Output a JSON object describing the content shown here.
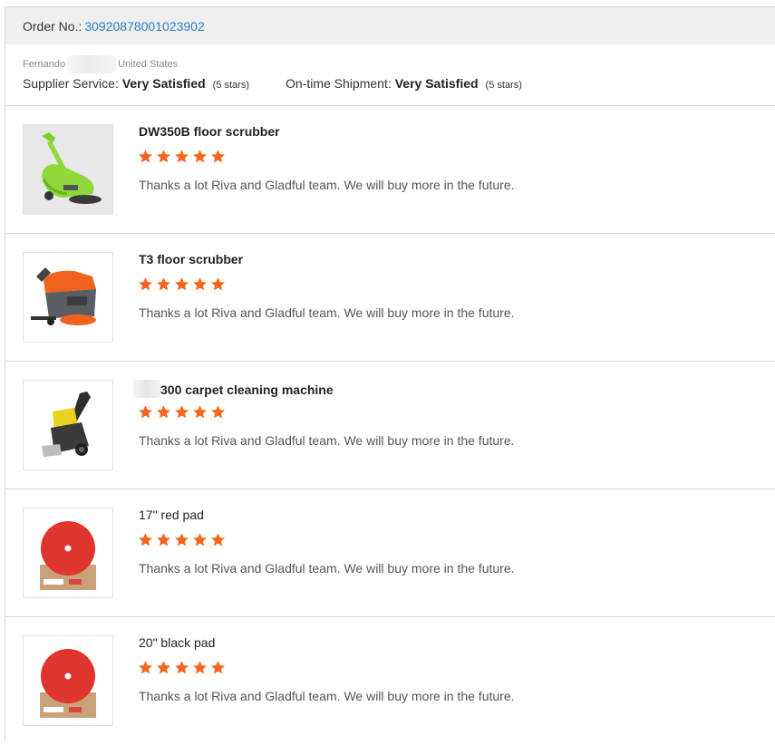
{
  "order": {
    "label": "Order No.:",
    "number": "30920878001023902"
  },
  "reviewer": {
    "name": "Fernando",
    "country": "United States"
  },
  "ratings": {
    "supplier_label": "Supplier Service:",
    "supplier_value": "Very Satisfied",
    "supplier_stars": "(5 stars)",
    "shipment_label": "On-time Shipment:",
    "shipment_value": "Very Satisfied",
    "shipment_stars": "(5 stars)"
  },
  "colors": {
    "star": "#f2661f",
    "order_link": "#2f7cc7"
  },
  "reviews": [
    {
      "product": "DW350B floor scrubber",
      "stars": 5,
      "text": "Thanks a lot Riva and Gladful team. We will buy more in the future.",
      "image": "green-floor-scrubber"
    },
    {
      "product": "T3 floor scrubber",
      "stars": 5,
      "text": "Thanks a lot Riva and Gladful team. We will buy more in the future.",
      "image": "orange-floor-scrubber"
    },
    {
      "product": "300 carpet cleaning machine",
      "stars": 5,
      "text": "Thanks a lot Riva and Gladful team. We will buy more in the future.",
      "image": "carpet-cleaning-machine"
    },
    {
      "product": "17\" red pad",
      "stars": 5,
      "text": "Thanks a lot Riva and Gladful team. We will buy more in the future.",
      "image": "red-pad"
    },
    {
      "product": "20\" black pad",
      "stars": 5,
      "text": "Thanks a lot Riva and Gladful team. We will buy more in the future.",
      "image": "red-pad"
    }
  ]
}
